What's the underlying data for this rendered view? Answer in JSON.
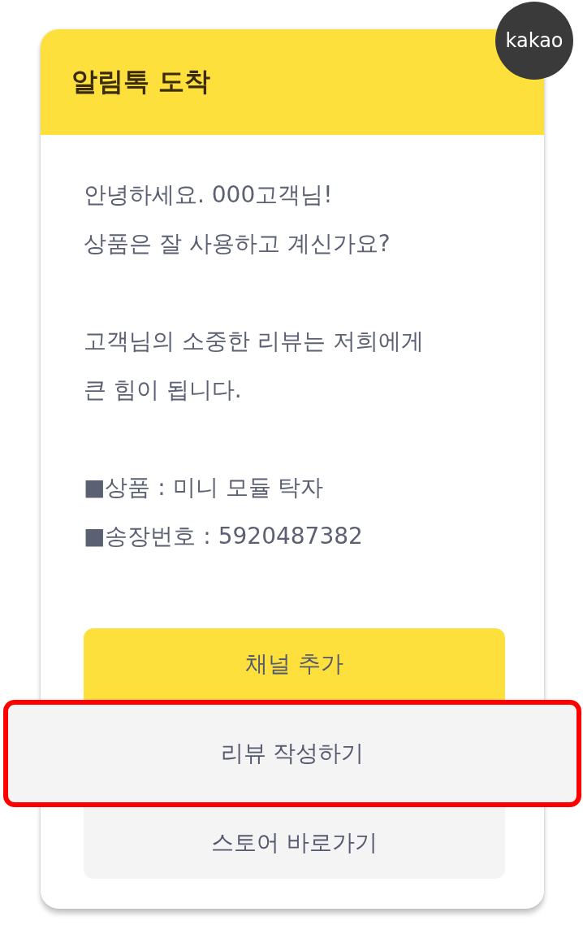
{
  "header": {
    "title": "알림톡 도착",
    "badge": "kakao"
  },
  "message": [
    {
      "lines": [
        "안녕하세요. 000고객님!",
        "상품은 잘 사용하고 계신가요?"
      ]
    },
    {
      "lines": [
        "고객님의 소중한 리뷰는 저희에게",
        "큰 힘이 됩니다."
      ]
    },
    {
      "lines": [
        "■상품 : 미니 모듈 탁자",
        "■송장번호 : 5920487382"
      ]
    }
  ],
  "buttons": [
    {
      "label": "채널 추가",
      "kind": "primary",
      "highlighted": false
    },
    {
      "label": "리뷰 작성하기",
      "kind": "secondary",
      "highlighted": true
    },
    {
      "label": "스토어 바로가기",
      "kind": "secondary",
      "highlighted": false
    }
  ]
}
